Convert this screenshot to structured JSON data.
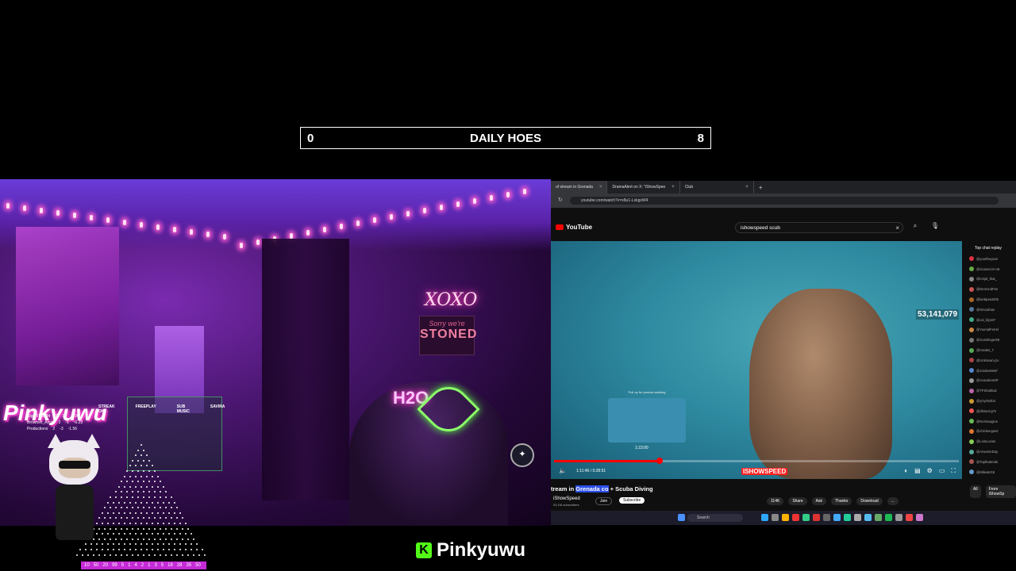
{
  "counter": {
    "left_value": "0",
    "title": "DAILY HOES",
    "right_value": "8"
  },
  "webcam": {
    "neon_xoxo": "XOXO",
    "sign_small": "Sorry we're",
    "sign_big": "STONED",
    "neon_h2o": "H2O",
    "overlay_logo": "Pinkyuwu",
    "scoreboard": {
      "headers": [
        "STREAK ON",
        "FREEPLAY",
        "SUB MUSIC",
        "SAVIRA"
      ],
      "rows": [
        [
          "NightFlash84",
          "7",
          "16",
          "0.00"
        ],
        [
          "Brownsh_Arcal",
          "2",
          "-1",
          "-0.23"
        ],
        [
          "Productions",
          "2",
          "-3",
          "-1.56"
        ]
      ]
    },
    "strip_numbers": [
      "10",
      "50",
      "20",
      "99",
      "5",
      "1",
      "4",
      "2",
      "1",
      "3",
      "5",
      "18",
      "28",
      "35",
      "50"
    ]
  },
  "browser": {
    "tabs": [
      {
        "label": "of stream in Grenada",
        "active": true
      },
      {
        "label": "DramaAlert on X: \"iShowSpee",
        "active": false
      },
      {
        "label": "Club",
        "active": false
      }
    ],
    "url": "youtube.com/watch?v=x8u1-LxkgxW4",
    "yt_logo": "YouTube",
    "search_query": "ishowspeed scub",
    "video": {
      "view_count": "53,141,079",
      "preview_label": "Pull up for precise seeking",
      "preview_time": "1:23:00",
      "time": "1:11:46 / 5:28:51",
      "progress": 0.26,
      "watermark": "ISHOWSPEED"
    },
    "chat": {
      "header": "Top chat replay",
      "users": [
        "@yourtheyave",
        "@GooseCrz-n8",
        "@tonjal_that_",
        "@DemondFee",
        "@lankpas3205",
        "@Smoothan",
        "@uni_lily187",
        "@YuenalFerrel",
        "@Gunslinger69",
        "@mewks_7",
        "@Unknown-j1v",
        "@JordansWef",
        "@AcandomHP",
        "@TFShahbaz",
        "@yOyOs2b4",
        "@dhined-g7s",
        "@NoriVaugine",
        "@chickengoes",
        "@LoisLucian",
        "@ArwosreDay",
        "@Topthatmobi",
        "@MiliedeG8",
        "@JoeeBalltell"
      ],
      "avatar_colors": [
        "#d34",
        "#6a4",
        "#888",
        "#c55",
        "#a62",
        "#579",
        "#4a8",
        "#c84",
        "#777",
        "#5a5",
        "#a44",
        "#58c",
        "#999",
        "#b6a",
        "#c93",
        "#e55",
        "#6b5",
        "#d73",
        "#8c5",
        "#5a9",
        "#a55",
        "#69c",
        "#c46"
      ],
      "tabs": [
        "All",
        "From iShowSp"
      ]
    },
    "title_pre": "tream in ",
    "title_hl": "Grenada co",
    "title_post": " + Scuba Diving",
    "channel": "iShowSpeed",
    "subscribers": "53.1M subscribers",
    "join": "Join",
    "subscribe": "Subscribe",
    "actions": [
      "114K",
      "Share",
      "Ask",
      "Thanks",
      "Download",
      "..."
    ],
    "taskbar_search": "Search"
  },
  "brand": {
    "name": "Pinkyuwu",
    "icon": "K"
  }
}
